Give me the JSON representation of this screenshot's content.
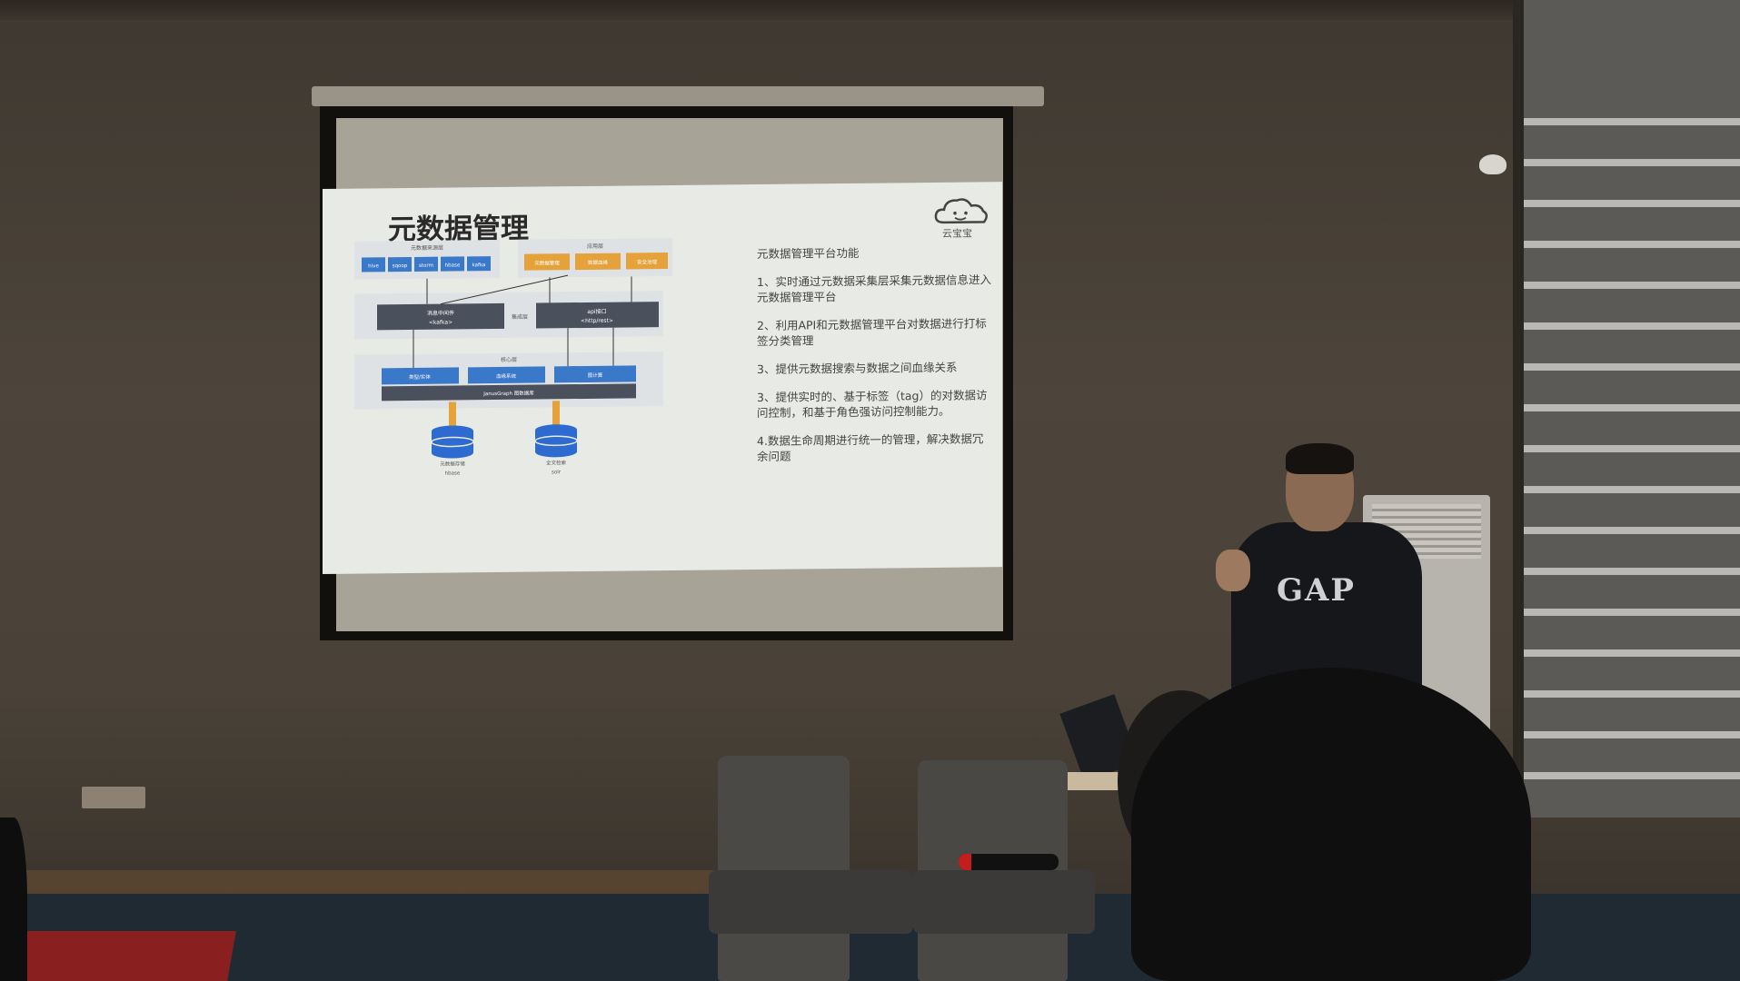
{
  "slide": {
    "title": "元数据管理",
    "logo_text": "云宝宝",
    "list_heading": "元数据管理平台功能",
    "list_items": [
      "1、实时通过元数据采集层采集元数据信息进入元数据管理平台",
      "2、利用API和元数据管理平台对数据进行打标签分类管理",
      "3、提供元数据搜索与数据之间血缘关系",
      "3、提供实时的、基于标签（tag）的对数据访问控制，和基于角色强访问控制能力。",
      "4.数据生命周期进行统一的管理，解决数据冗余问题"
    ]
  },
  "diagram": {
    "group_top_left": "元数据来源层",
    "sources": [
      "hive",
      "sqoop",
      "storm",
      "hbase",
      "kafka"
    ],
    "group_top_right": "应用层",
    "apps": [
      "元数据管理",
      "数据血缘",
      "安全治理"
    ],
    "middle_label": "集成层",
    "msg_box": "消息中间件",
    "msg_sub": "<kafka>",
    "api_box": "api接口",
    "api_sub": "<http/rest>",
    "core_label": "核心层",
    "core_items": [
      "类型/实体",
      "血缘系统",
      "图计算"
    ],
    "core_bar": "JanusGraph 图数据库",
    "db_left_label": "元数据存储",
    "db_left_sub": "hbase",
    "db_right_label": "全文检索",
    "db_right_sub": "solr"
  },
  "shirt_logo": "GAP",
  "colors": {
    "source_blue": "#3a78c9",
    "app_orange": "#e5a23a",
    "dark_box": "#4a505c",
    "db_blue": "#2e6bd1"
  }
}
